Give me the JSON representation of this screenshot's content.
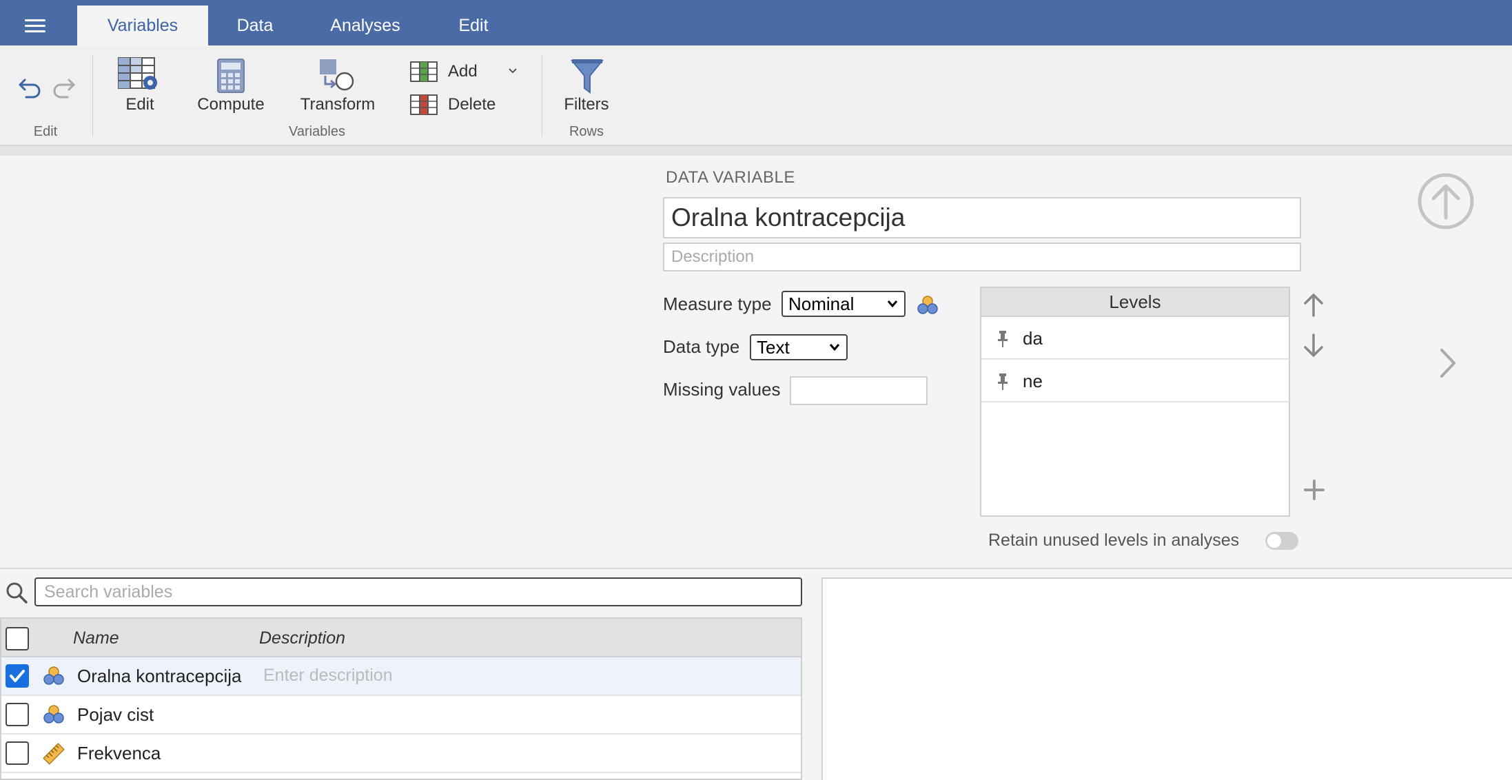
{
  "app": {
    "tabs": [
      {
        "label": "Variables",
        "active": true
      },
      {
        "label": "Data"
      },
      {
        "label": "Analyses"
      },
      {
        "label": "Edit"
      }
    ]
  },
  "ribbon": {
    "undo_icon": "undo-icon",
    "redo_icon": "redo-icon",
    "edit_group": "Edit",
    "edit_label": "Edit",
    "compute_label": "Compute",
    "transform_label": "Transform",
    "add_label": "Add",
    "delete_label": "Delete",
    "variables_group": "Variables",
    "filters_label": "Filters",
    "rows_group": "Rows"
  },
  "editor": {
    "section_title": "DATA VARIABLE",
    "variable_name": "Oralna kontracepcija",
    "description_placeholder": "Description",
    "measure_type_label": "Measure type",
    "measure_type_value": "Nominal",
    "data_type_label": "Data type",
    "data_type_value": "Text",
    "missing_values_label": "Missing values",
    "missing_values_value": "",
    "levels_header": "Levels",
    "levels": [
      "da",
      "ne"
    ],
    "retain_label": "Retain unused levels in analyses",
    "retain_on": false
  },
  "variables_list": {
    "search_placeholder": "Search variables",
    "col_name": "Name",
    "col_description": "Description",
    "rows": [
      {
        "name": "Oralna kontracepcija",
        "description": "Enter description",
        "checked": true,
        "type": "nominal"
      },
      {
        "name": "Pojav cist",
        "description": "",
        "checked": false,
        "type": "nominal"
      },
      {
        "name": "Frekvenca",
        "description": "",
        "checked": false,
        "type": "continuous"
      }
    ]
  },
  "colors": {
    "topbar": "#4a6ba6",
    "accent": "#3e64a8",
    "checkbox": "#1a6fe0"
  }
}
